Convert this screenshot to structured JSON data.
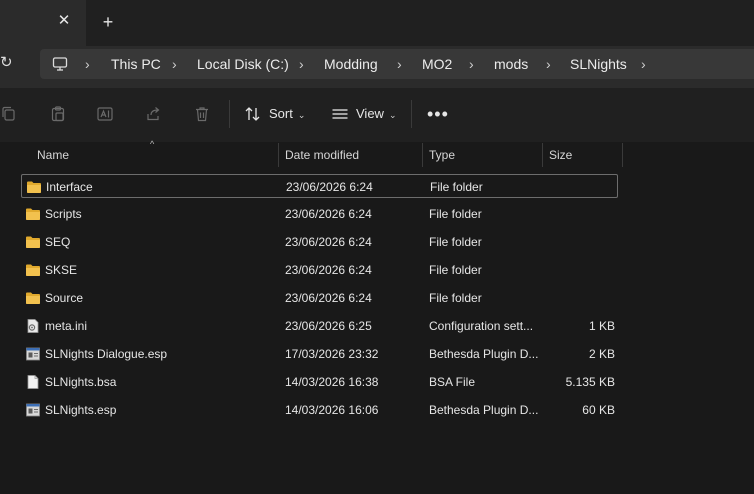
{
  "tabbar": {
    "close_glyph": "✕",
    "new_tab_glyph": "+"
  },
  "nav": {
    "refresh_glyph": "↻"
  },
  "breadcrumb": [
    {
      "label": "This PC"
    },
    {
      "label": "Local Disk (C:)"
    },
    {
      "label": "Modding"
    },
    {
      "label": "MO2"
    },
    {
      "label": "mods"
    },
    {
      "label": "SLNights"
    }
  ],
  "breadcrumb_separator": "›",
  "toolbar": {
    "sort_label": "Sort",
    "view_label": "View",
    "more_glyph": "•••",
    "chevron_glyph": "⌄",
    "icons": [
      "copy-icon",
      "paste-icon",
      "rename-icon",
      "share-icon",
      "delete-icon",
      "sort-icon",
      "view-icon"
    ]
  },
  "columns": {
    "name": "Name",
    "date": "Date modified",
    "type": "Type",
    "size": "Size",
    "sort_glyph": "^"
  },
  "files": [
    {
      "name": "Interface",
      "date": "23/06/2026 6:24",
      "type": "File folder",
      "size": "",
      "icon": "folder-icon",
      "selected": true
    },
    {
      "name": "Scripts",
      "date": "23/06/2026 6:24",
      "type": "File folder",
      "size": "",
      "icon": "folder-icon"
    },
    {
      "name": "SEQ",
      "date": "23/06/2026 6:24",
      "type": "File folder",
      "size": "",
      "icon": "folder-icon"
    },
    {
      "name": "SKSE",
      "date": "23/06/2026 6:24",
      "type": "File folder",
      "size": "",
      "icon": "folder-icon"
    },
    {
      "name": "Source",
      "date": "23/06/2026 6:24",
      "type": "File folder",
      "size": "",
      "icon": "folder-icon"
    },
    {
      "name": "meta.ini",
      "date": "23/06/2026 6:25",
      "type": "Configuration sett...",
      "size": "1 KB",
      "icon": "config-file-icon"
    },
    {
      "name": "SLNights Dialogue.esp",
      "date": "17/03/2026 23:32",
      "type": "Bethesda Plugin D...",
      "size": "2 KB",
      "icon": "plugin-file-icon"
    },
    {
      "name": "SLNights.bsa",
      "date": "14/03/2026 16:38",
      "type": "BSA File",
      "size": "5.135 KB",
      "icon": "file-icon"
    },
    {
      "name": "SLNights.esp",
      "date": "14/03/2026 16:06",
      "type": "Bethesda Plugin D...",
      "size": "60 KB",
      "icon": "plugin-file-icon"
    }
  ],
  "colors": {
    "folder": "#f2c14e",
    "accent_border": "#6d6d6d",
    "background": "#191919"
  }
}
